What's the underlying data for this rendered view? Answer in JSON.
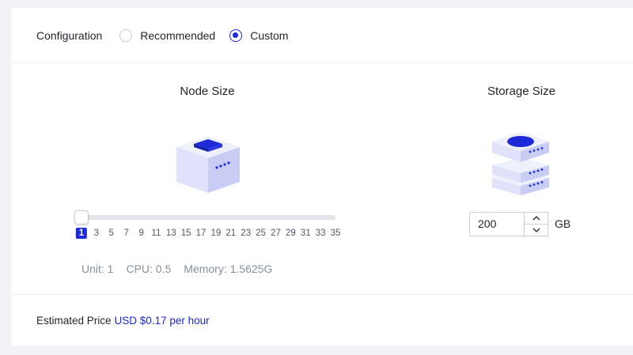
{
  "configuration": {
    "label": "Configuration",
    "options": [
      {
        "label": "Recommended",
        "selected": false
      },
      {
        "label": "Custom",
        "selected": true
      }
    ]
  },
  "node_size": {
    "title": "Node Size",
    "ticks": [
      "1",
      "3",
      "5",
      "7",
      "9",
      "11",
      "13",
      "15",
      "17",
      "19",
      "21",
      "23",
      "25",
      "27",
      "29",
      "31",
      "33",
      "35"
    ],
    "selected": "1",
    "specs": {
      "unit": "Unit: 1",
      "cpu": "CPU: 0.5",
      "memory": "Memory: 1.5625G"
    }
  },
  "storage_size": {
    "title": "Storage Size",
    "value": "200",
    "unit": "GB"
  },
  "price": {
    "label": "Estimated Price",
    "value": "USD $0.17 per hour"
  },
  "colors": {
    "accent": "#1d2ad8",
    "icon_light": "#e6e8fb",
    "icon_mid": "#c7cbf3"
  }
}
